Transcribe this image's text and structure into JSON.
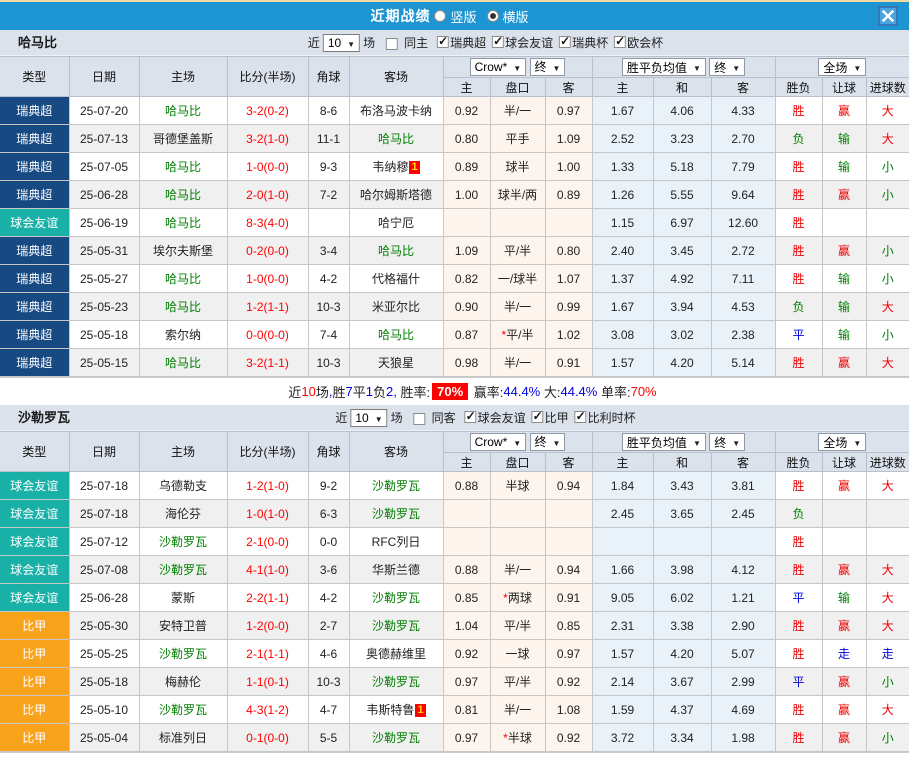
{
  "titlebar": {
    "title": "近期战绩",
    "radios": [
      {
        "label": "竖版",
        "checked": false
      },
      {
        "label": "横版",
        "checked": true
      }
    ]
  },
  "colors": {
    "titlebar": "#1d95d3",
    "bar_bg": "#dce2ec",
    "league": {
      "瑞典超": "#174982",
      "球会友谊": "#19b1a7",
      "比甲": "#f9a21c"
    },
    "score": "#ff0000",
    "focus_team": "#008000",
    "asian_col_bg": "#fdf5ed",
    "euro_col_bg": "#e9f2f8",
    "result": {
      "胜": "red",
      "赢": "red",
      "大": "red",
      "负": "green",
      "输": "green",
      "小": "green",
      "平": "blue",
      "走": "blue"
    }
  },
  "header": {
    "type": "类型",
    "date": "日期",
    "home": "主场",
    "score": "比分(半场)",
    "corner": "角球",
    "away": "客场",
    "asian_company_select": "Crow*",
    "asian_final_select": "终",
    "euro_select": "胜平负均值",
    "euro_final_select": "终",
    "scope_select": "全场",
    "sub": [
      "主",
      "盘口",
      "客",
      "主",
      "和",
      "客",
      "胜负",
      "让球",
      "进球数"
    ]
  },
  "filter_labels": {
    "prefix": "近",
    "suffix": "场",
    "count": "10"
  },
  "sections": [
    {
      "team": "哈马比",
      "filter": {
        "count": "10",
        "same_label": "同主",
        "same_checked": false,
        "leagues": [
          {
            "label": "瑞典超",
            "checked": true
          },
          {
            "label": "球会友谊",
            "checked": true
          },
          {
            "label": "瑞典杯",
            "checked": true
          },
          {
            "label": "欧会杯",
            "checked": true
          }
        ]
      },
      "rows": [
        {
          "league": "瑞典超",
          "date": "25-07-20",
          "home": "哈马比",
          "home_focus": true,
          "score": "3-2(0-2)",
          "corner": "8-6",
          "away": "布洛马波卡纳",
          "away_focus": false,
          "away_badge": "",
          "asian_home": "0.92",
          "handicap": "半/一",
          "handicap_star": false,
          "asian_away": "0.97",
          "euro_home": "1.67",
          "euro_draw": "4.06",
          "euro_away": "4.33",
          "result": "胜",
          "handicap_result": "赢",
          "goal_result": "大"
        },
        {
          "league": "瑞典超",
          "date": "25-07-13",
          "home": "哥德堡盖斯",
          "home_focus": false,
          "score": "3-2(1-0)",
          "corner": "11-1",
          "away": "哈马比",
          "away_focus": true,
          "away_badge": "",
          "asian_home": "0.80",
          "handicap": "平手",
          "handicap_star": false,
          "asian_away": "1.09",
          "euro_home": "2.52",
          "euro_draw": "3.23",
          "euro_away": "2.70",
          "result": "负",
          "handicap_result": "输",
          "goal_result": "大"
        },
        {
          "league": "瑞典超",
          "date": "25-07-05",
          "home": "哈马比",
          "home_focus": true,
          "score": "1-0(0-0)",
          "corner": "9-3",
          "away": "韦纳穆",
          "away_focus": false,
          "away_badge": "1",
          "asian_home": "0.89",
          "handicap": "球半",
          "handicap_star": false,
          "asian_away": "1.00",
          "euro_home": "1.33",
          "euro_draw": "5.18",
          "euro_away": "7.79",
          "result": "胜",
          "handicap_result": "输",
          "goal_result": "小"
        },
        {
          "league": "瑞典超",
          "date": "25-06-28",
          "home": "哈马比",
          "home_focus": true,
          "score": "2-0(1-0)",
          "corner": "7-2",
          "away": "哈尔姆斯塔德",
          "away_focus": false,
          "away_badge": "",
          "asian_home": "1.00",
          "handicap": "球半/两",
          "handicap_star": false,
          "asian_away": "0.89",
          "euro_home": "1.26",
          "euro_draw": "5.55",
          "euro_away": "9.64",
          "result": "胜",
          "handicap_result": "赢",
          "goal_result": "小"
        },
        {
          "league": "球会友谊",
          "date": "25-06-19",
          "home": "哈马比",
          "home_focus": true,
          "score": "8-3(4-0)",
          "corner": "",
          "away": "哈宁厄",
          "away_focus": false,
          "away_badge": "",
          "asian_home": "",
          "handicap": "",
          "handicap_star": false,
          "asian_away": "",
          "euro_home": "1.15",
          "euro_draw": "6.97",
          "euro_away": "12.60",
          "result": "胜",
          "handicap_result": "",
          "goal_result": ""
        },
        {
          "league": "瑞典超",
          "date": "25-05-31",
          "home": "埃尔夫斯堡",
          "home_focus": false,
          "score": "0-2(0-0)",
          "corner": "3-4",
          "away": "哈马比",
          "away_focus": true,
          "away_badge": "",
          "asian_home": "1.09",
          "handicap": "平/半",
          "handicap_star": false,
          "asian_away": "0.80",
          "euro_home": "2.40",
          "euro_draw": "3.45",
          "euro_away": "2.72",
          "result": "胜",
          "handicap_result": "赢",
          "goal_result": "小"
        },
        {
          "league": "瑞典超",
          "date": "25-05-27",
          "home": "哈马比",
          "home_focus": true,
          "score": "1-0(0-0)",
          "corner": "4-2",
          "away": "代格福什",
          "away_focus": false,
          "away_badge": "",
          "asian_home": "0.82",
          "handicap": "一/球半",
          "handicap_star": false,
          "asian_away": "1.07",
          "euro_home": "1.37",
          "euro_draw": "4.92",
          "euro_away": "7.11",
          "result": "胜",
          "handicap_result": "输",
          "goal_result": "小"
        },
        {
          "league": "瑞典超",
          "date": "25-05-23",
          "home": "哈马比",
          "home_focus": true,
          "score": "1-2(1-1)",
          "corner": "10-3",
          "away": "米亚尔比",
          "away_focus": false,
          "away_badge": "",
          "asian_home": "0.90",
          "handicap": "半/一",
          "handicap_star": false,
          "asian_away": "0.99",
          "euro_home": "1.67",
          "euro_draw": "3.94",
          "euro_away": "4.53",
          "result": "负",
          "handicap_result": "输",
          "goal_result": "大"
        },
        {
          "league": "瑞典超",
          "date": "25-05-18",
          "home": "索尔纳",
          "home_focus": false,
          "score": "0-0(0-0)",
          "corner": "7-4",
          "away": "哈马比",
          "away_focus": true,
          "away_badge": "",
          "asian_home": "0.87",
          "handicap": "平/半",
          "handicap_star": true,
          "asian_away": "1.02",
          "euro_home": "3.08",
          "euro_draw": "3.02",
          "euro_away": "2.38",
          "result": "平",
          "handicap_result": "输",
          "goal_result": "小"
        },
        {
          "league": "瑞典超",
          "date": "25-05-15",
          "home": "哈马比",
          "home_focus": true,
          "score": "3-2(1-1)",
          "corner": "10-3",
          "away": "天狼星",
          "away_focus": false,
          "away_badge": "",
          "asian_home": "0.98",
          "handicap": "半/一",
          "handicap_star": false,
          "asian_away": "0.91",
          "euro_home": "1.57",
          "euro_draw": "4.20",
          "euro_away": "5.14",
          "result": "胜",
          "handicap_result": "赢",
          "goal_result": "大"
        }
      ],
      "summary": [
        {
          "text": "近",
          "style": "k"
        },
        {
          "text": "10",
          "style": "r"
        },
        {
          "text": "场",
          "style": "k"
        },
        {
          "text": ",",
          "style": "b"
        },
        {
          "text": "胜",
          "style": "k"
        },
        {
          "text": "7",
          "style": "b"
        },
        {
          "text": "平",
          "style": "k"
        },
        {
          "text": "1",
          "style": "b"
        },
        {
          "text": "负",
          "style": "k"
        },
        {
          "text": "2",
          "style": "b"
        },
        {
          "text": ", ",
          "style": "b"
        },
        {
          "text": "胜率:",
          "style": "k"
        },
        {
          "text": "70%",
          "style": "badge"
        },
        {
          "text": " 赢率:",
          "style": "k"
        },
        {
          "text": "44.4%",
          "style": "b"
        },
        {
          "text": " 大:",
          "style": "k"
        },
        {
          "text": "44.4%",
          "style": "b"
        },
        {
          "text": " 单率:",
          "style": "k"
        },
        {
          "text": "70%",
          "style": "r"
        }
      ]
    },
    {
      "team": "沙勒罗瓦",
      "filter": {
        "count": "10",
        "same_label": "同客",
        "same_checked": false,
        "leagues": [
          {
            "label": "球会友谊",
            "checked": true
          },
          {
            "label": "比甲",
            "checked": true
          },
          {
            "label": "比利时杯",
            "checked": true
          }
        ]
      },
      "rows": [
        {
          "league": "球会友谊",
          "date": "25-07-18",
          "home": "乌德勒支",
          "home_focus": false,
          "score": "1-2(1-0)",
          "corner": "9-2",
          "away": "沙勒罗瓦",
          "away_focus": true,
          "away_badge": "",
          "asian_home": "0.88",
          "handicap": "半球",
          "handicap_star": false,
          "asian_away": "0.94",
          "euro_home": "1.84",
          "euro_draw": "3.43",
          "euro_away": "3.81",
          "result": "胜",
          "handicap_result": "赢",
          "goal_result": "大"
        },
        {
          "league": "球会友谊",
          "date": "25-07-18",
          "home": "海伦芬",
          "home_focus": false,
          "score": "1-0(1-0)",
          "corner": "6-3",
          "away": "沙勒罗瓦",
          "away_focus": true,
          "away_badge": "",
          "asian_home": "",
          "handicap": "",
          "handicap_star": false,
          "asian_away": "",
          "euro_home": "2.45",
          "euro_draw": "3.65",
          "euro_away": "2.45",
          "result": "负",
          "handicap_result": "",
          "goal_result": ""
        },
        {
          "league": "球会友谊",
          "date": "25-07-12",
          "home": "沙勒罗瓦",
          "home_focus": true,
          "score": "2-1(0-0)",
          "corner": "0-0",
          "away": "RFC列日",
          "away_focus": false,
          "away_badge": "",
          "asian_home": "",
          "handicap": "",
          "handicap_star": false,
          "asian_away": "",
          "euro_home": "",
          "euro_draw": "",
          "euro_away": "",
          "result": "胜",
          "handicap_result": "",
          "goal_result": ""
        },
        {
          "league": "球会友谊",
          "date": "25-07-08",
          "home": "沙勒罗瓦",
          "home_focus": true,
          "score": "4-1(1-0)",
          "corner": "3-6",
          "away": "华斯兰德",
          "away_focus": false,
          "away_badge": "",
          "asian_home": "0.88",
          "handicap": "半/一",
          "handicap_star": false,
          "asian_away": "0.94",
          "euro_home": "1.66",
          "euro_draw": "3.98",
          "euro_away": "4.12",
          "result": "胜",
          "handicap_result": "赢",
          "goal_result": "大"
        },
        {
          "league": "球会友谊",
          "date": "25-06-28",
          "home": "蒙斯",
          "home_focus": false,
          "score": "2-2(1-1)",
          "corner": "4-2",
          "away": "沙勒罗瓦",
          "away_focus": true,
          "away_badge": "",
          "asian_home": "0.85",
          "handicap": "两球",
          "handicap_star": true,
          "asian_away": "0.91",
          "euro_home": "9.05",
          "euro_draw": "6.02",
          "euro_away": "1.21",
          "result": "平",
          "handicap_result": "输",
          "goal_result": "大"
        },
        {
          "league": "比甲",
          "date": "25-05-30",
          "home": "安特卫普",
          "home_focus": false,
          "score": "1-2(0-0)",
          "corner": "2-7",
          "away": "沙勒罗瓦",
          "away_focus": true,
          "away_badge": "",
          "asian_home": "1.04",
          "handicap": "平/半",
          "handicap_star": false,
          "asian_away": "0.85",
          "euro_home": "2.31",
          "euro_draw": "3.38",
          "euro_away": "2.90",
          "result": "胜",
          "handicap_result": "赢",
          "goal_result": "大"
        },
        {
          "league": "比甲",
          "date": "25-05-25",
          "home": "沙勒罗瓦",
          "home_focus": true,
          "score": "2-1(1-1)",
          "corner": "4-6",
          "away": "奥德赫维里",
          "away_focus": false,
          "away_badge": "",
          "asian_home": "0.92",
          "handicap": "一球",
          "handicap_star": false,
          "asian_away": "0.97",
          "euro_home": "1.57",
          "euro_draw": "4.20",
          "euro_away": "5.07",
          "result": "胜",
          "handicap_result": "走",
          "goal_result": "走"
        },
        {
          "league": "比甲",
          "date": "25-05-18",
          "home": "梅赫伦",
          "home_focus": false,
          "score": "1-1(0-1)",
          "corner": "10-3",
          "away": "沙勒罗瓦",
          "away_focus": true,
          "away_badge": "",
          "asian_home": "0.97",
          "handicap": "平/半",
          "handicap_star": false,
          "asian_away": "0.92",
          "euro_home": "2.14",
          "euro_draw": "3.67",
          "euro_away": "2.99",
          "result": "平",
          "handicap_result": "赢",
          "goal_result": "小"
        },
        {
          "league": "比甲",
          "date": "25-05-10",
          "home": "沙勒罗瓦",
          "home_focus": true,
          "score": "4-3(1-2)",
          "corner": "4-7",
          "away": "韦斯特鲁",
          "away_focus": false,
          "away_badge": "1",
          "asian_home": "0.81",
          "handicap": "半/一",
          "handicap_star": false,
          "asian_away": "1.08",
          "euro_home": "1.59",
          "euro_draw": "4.37",
          "euro_away": "4.69",
          "result": "胜",
          "handicap_result": "赢",
          "goal_result": "大"
        },
        {
          "league": "比甲",
          "date": "25-05-04",
          "home": "标准列日",
          "home_focus": false,
          "score": "0-1(0-0)",
          "corner": "5-5",
          "away": "沙勒罗瓦",
          "away_focus": true,
          "away_badge": "",
          "asian_home": "0.97",
          "handicap": "半球",
          "handicap_star": true,
          "asian_away": "0.92",
          "euro_home": "3.72",
          "euro_draw": "3.34",
          "euro_away": "1.98",
          "result": "胜",
          "handicap_result": "赢",
          "goal_result": "小"
        }
      ],
      "summary": []
    }
  ]
}
